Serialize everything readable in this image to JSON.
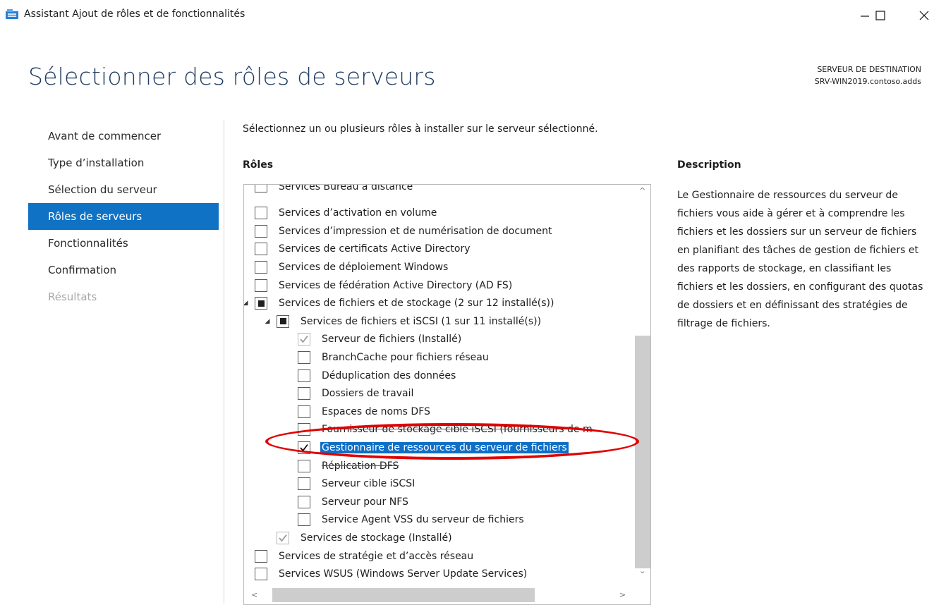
{
  "window": {
    "title": "Assistant Ajout de rôles et de fonctionnalités",
    "minimize_glyph": "–",
    "maximize_glyph": "☐",
    "close_glyph": "✕"
  },
  "page": {
    "title": "Sélectionner des rôles de serveurs",
    "destination_label": "SERVEUR DE DESTINATION",
    "destination_server": "SRV-WIN2019.contoso.adds"
  },
  "nav": {
    "items": [
      {
        "label": "Avant de commencer",
        "state": "normal"
      },
      {
        "label": "Type d’installation",
        "state": "normal"
      },
      {
        "label": "Sélection du serveur",
        "state": "normal"
      },
      {
        "label": "Rôles de serveurs",
        "state": "active"
      },
      {
        "label": "Fonctionnalités",
        "state": "normal"
      },
      {
        "label": "Confirmation",
        "state": "normal"
      },
      {
        "label": "Résultats",
        "state": "disabled"
      }
    ]
  },
  "main": {
    "intro": "Sélectionnez un ou plusieurs rôles à installer sur le serveur sélectionné.",
    "roles_header": "Rôles",
    "description_header": "Description",
    "description": "Le Gestionnaire de ressources du serveur de fichiers vous aide à gérer et à comprendre les fichiers et les dossiers sur un serveur de fichiers en planifiant des tâches de gestion de fichiers et des rapports de stockage, en classifiant les fichiers et les dossiers, en configurant des quotas de dossiers et en définissant des stratégies de filtrage de fichiers."
  },
  "roles": {
    "items": [
      {
        "label": "Services Bureau à distance",
        "level": 0,
        "check": "unchecked"
      },
      {
        "label": "Services d’activation en volume",
        "level": 0,
        "check": "unchecked"
      },
      {
        "label": "Services d’impression et de numérisation de document",
        "level": 0,
        "check": "unchecked"
      },
      {
        "label": "Services de certificats Active Directory",
        "level": 0,
        "check": "unchecked"
      },
      {
        "label": "Services de déploiement Windows",
        "level": 0,
        "check": "unchecked"
      },
      {
        "label": "Services de fédération Active Directory (AD FS)",
        "level": 0,
        "check": "unchecked"
      },
      {
        "label": "Services de fichiers et de stockage (2 sur 12 installé(s))",
        "level": 0,
        "check": "partial",
        "expander": "◢"
      },
      {
        "label": "Services de fichiers et iSCSI (1 sur 11 installé(s))",
        "level": 1,
        "check": "partial",
        "expander": "◢"
      },
      {
        "label": "Serveur de fichiers (Installé)",
        "level": 2,
        "check": "checked-disabled"
      },
      {
        "label": "BranchCache pour fichiers réseau",
        "level": 2,
        "check": "unchecked"
      },
      {
        "label": "Déduplication des données",
        "level": 2,
        "check": "unchecked"
      },
      {
        "label": "Dossiers de travail",
        "level": 2,
        "check": "unchecked"
      },
      {
        "label": "Espaces de noms DFS",
        "level": 2,
        "check": "unchecked"
      },
      {
        "label": "Fournisseur de stockage cible iSCSI (fournisseurs de m",
        "level": 2,
        "check": "unchecked",
        "struck": true
      },
      {
        "label": "Gestionnaire de ressources du serveur de fichiers",
        "level": 2,
        "check": "checked",
        "selected": true
      },
      {
        "label": "Réplication DFS",
        "level": 2,
        "check": "unchecked",
        "struck": true
      },
      {
        "label": "Serveur cible iSCSI",
        "level": 2,
        "check": "unchecked"
      },
      {
        "label": "Serveur pour NFS",
        "level": 2,
        "check": "unchecked"
      },
      {
        "label": "Service Agent VSS du serveur de fichiers",
        "level": 2,
        "check": "unchecked"
      },
      {
        "label": "Services de stockage (Installé)",
        "level": 1,
        "check": "checked-disabled"
      },
      {
        "label": "Services de stratégie et d’accès réseau",
        "level": 0,
        "check": "unchecked"
      },
      {
        "label": "Services WSUS (Windows Server Update Services)",
        "level": 0,
        "check": "unchecked"
      }
    ]
  },
  "scroll": {
    "up": "^",
    "down": "⌄",
    "left": "<",
    "right": ">"
  },
  "colors": {
    "accent": "#1072c4",
    "selection": "#0f6fc6",
    "title": "#1f3c62",
    "annotation": "#e00000"
  }
}
